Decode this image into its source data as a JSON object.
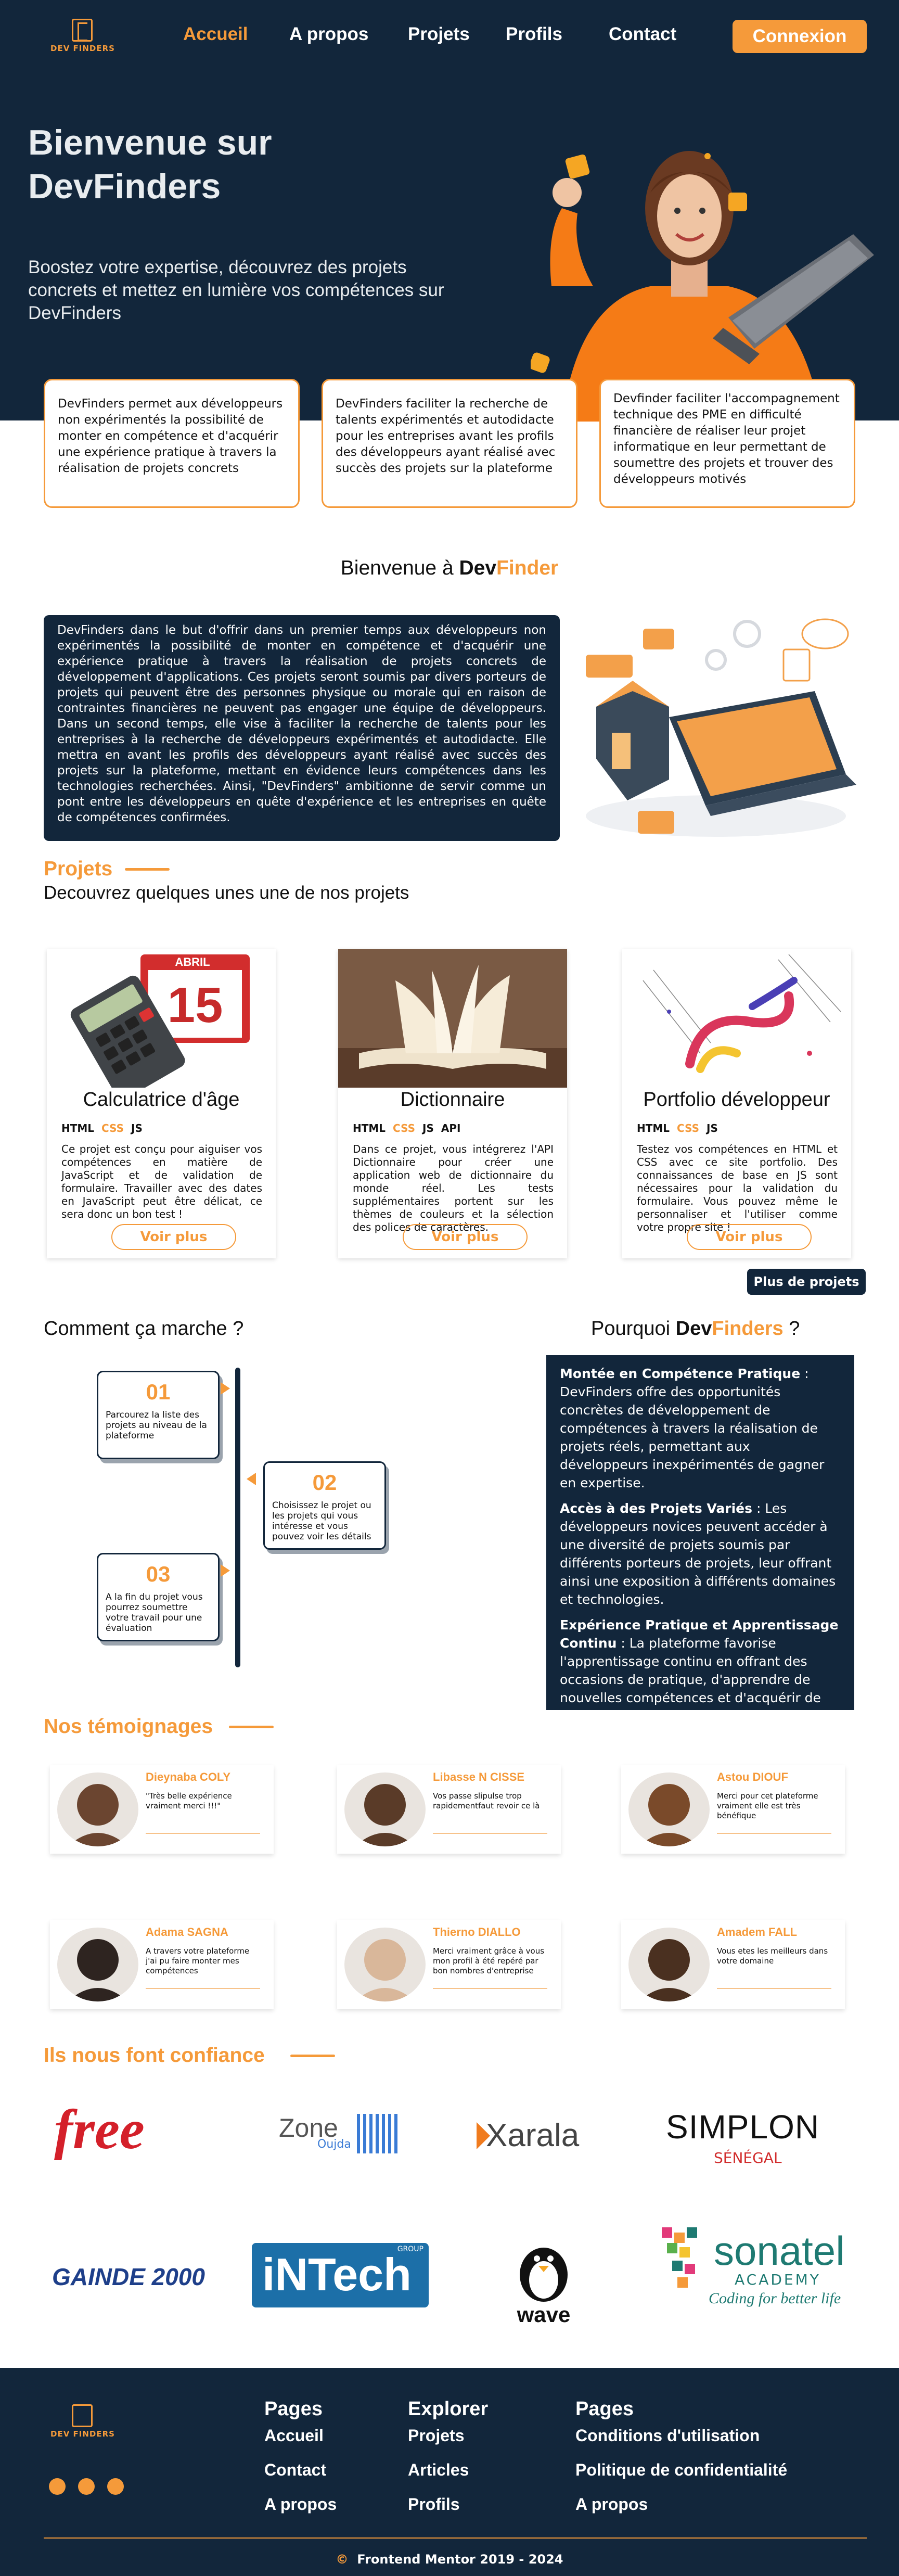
{
  "nav": {
    "logo_text": "DEV FINDERS",
    "items": [
      "Accueil",
      "A propos",
      "Projets",
      "Profils",
      "Contact"
    ],
    "login": "Connexion"
  },
  "hero": {
    "title": "Bienvenue sur DevFinders",
    "subtitle": "Boostez votre expertise, découvrez des projets concrets et mettez en lumière vos compétences sur DevFinders"
  },
  "features": [
    "DevFinders permet aux développeurs non expérimentés la possibilité de monter en compétence et d'acquérir une expérience pratique à travers la réalisation de projets concrets",
    "DevFinders faciliter la recherche de talents expérimentés et autodidacte pour les entreprises avant les profils des développeurs ayant réalisé avec succès des projets sur la plateforme",
    "Devfinder faciliter l'accompagnement technique des PME en difficulté financière de réaliser leur projet informatique en leur permettant de soumettre des projets et trouver des développeurs motivés"
  ],
  "welcome": {
    "prefix": "Bienvenue à ",
    "dev": "Dev",
    "finder": "Finder"
  },
  "about": "DevFinders dans le but d'offrir dans un premier temps aux développeurs non expérimentés la possibilité de monter en compétence et d'acquérir une expérience pratique à travers la réalisation de projets concrets de développement d'applications. Ces projets seront soumis par divers porteurs de projets qui peuvent être des personnes physique ou morale qui en raison de contraintes financières ne peuvent pas engager une équipe de développeurs. Dans un second temps, elle vise à faciliter la recherche de talents pour les entreprises à la recherche de développeurs expérimentés et autodidacte. Elle mettra en avant les profils des développeurs ayant réalisé avec succès des projets sur la plateforme, mettant en évidence leurs compétences dans les technologies recherchées. Ainsi, \"DevFinders\" ambitionne de servir comme un pont entre les développeurs en quête d'expérience et les entreprises en quête de compétences confirmées.",
  "projects": {
    "title": "Projets",
    "subtitle": "Decouvrez quelques unes une de nos projets",
    "items": [
      {
        "title": "Calculatrice d'âge",
        "tags": [
          "HTML",
          "CSS",
          "JS"
        ],
        "desc": "Ce projet est conçu pour aiguiser vos compétences en matière de JavaScript et de validation de formulaire. Travailler avec des dates en JavaScript peut être délicat, ce sera donc un bon test !",
        "btn": "Voir plus"
      },
      {
        "title": "Dictionnaire",
        "tags": [
          "HTML",
          "CSS",
          "JS",
          "API"
        ],
        "desc": "Dans ce projet, vous intégrerez l'API Dictionnaire pour créer une application web de dictionnaire du monde réel. Les tests supplémentaires portent sur les thèmes de couleurs et la sélection des polices de caractères.",
        "btn": "Voir plus"
      },
      {
        "title": "Portfolio développeur",
        "tags": [
          "HTML",
          "CSS",
          "JS"
        ],
        "desc": "Testez vos compétences en HTML et CSS avec ce site portfolio. Des connaissances de base en JS sont nécessaires pour la validation du formulaire. Vous pouvez même le personnaliser et l'utiliser comme votre propre site !",
        "btn": "Voir plus"
      }
    ],
    "more": "Plus de projets"
  },
  "how": {
    "title": "Comment ça marche ?",
    "steps": [
      {
        "num": "01",
        "text": "Parcourez la liste des projets au niveau de la plateforme"
      },
      {
        "num": "02",
        "text": "Choisissez le projet ou les projets qui vous intéresse et vous pouvez voir les détails"
      },
      {
        "num": "03",
        "text": "A la fin du projet vous pourrez soumettre votre travail pour une évaluation"
      }
    ]
  },
  "why": {
    "prefix": "Pourquoi ",
    "dev": "Dev",
    "finders": "Finders",
    " suffix": " ?",
    "items": [
      {
        "h": "Montée en Compétence Pratique",
        "t": " : DevFinders offre des opportunités concrètes de développement de compétences à travers la réalisation de projets réels, permettant aux développeurs inexpérimentés de gagner en expertise."
      },
      {
        "h": "Accès à des Projets Variés",
        "t": " : Les développeurs novices peuvent accéder à une diversité de projets soumis par différents porteurs de projets, leur offrant ainsi une exposition à différents domaines et technologies."
      },
      {
        "h": "Expérience Pratique et Apprentissage Continu",
        "t": " : La plateforme favorise l'apprentissage continu en offrant des occasions de pratique, d'apprendre de nouvelles compétences et d'acquérir de l'expérience pratique."
      }
    ]
  },
  "testimonials": {
    "title": "Nos témoignages",
    "items": [
      {
        "name": "Dieynaba COLY",
        "quote": "\"Très belle expérience vraiment merci !!!\"",
        "skin": "#6b4530"
      },
      {
        "name": "Libasse N CISSE",
        "quote": "Vos passe slipulse trop rapidementfaut revoir ce là",
        "skin": "#5a3b28"
      },
      {
        "name": "Astou DIOUF",
        "quote": "Merci pour cet plateforme vraiment elle est très bénéfique",
        "skin": "#7a4a2a"
      },
      {
        "name": "Adama SAGNA",
        "quote": "A travers votre plateforme j'ai pu faire monter mes compétences",
        "skin": "#2e2420"
      },
      {
        "name": "Thierno DIALLO",
        "quote": "Merci vraiment grâce à vous mon profil à été repéré par bon nombres d'entreprise",
        "skin": "#d9b79a"
      },
      {
        "name": "Amadem FALL",
        "quote": "Vous etes les meilleurs dans votre domaine",
        "skin": "#4a3020"
      }
    ]
  },
  "partners": {
    "title": "Ils nous font confiance",
    "logos": [
      {
        "name": "free",
        "text": "free",
        "color": "#d4202a"
      },
      {
        "name": "zone01",
        "text": "Zone",
        "sub": "Oujda",
        "color": "#555555"
      },
      {
        "name": "xarala",
        "text": "Xarala",
        "color": "#444444"
      },
      {
        "name": "simplon",
        "text": "SIMPLON",
        "sub": "SÉNÉGAL",
        "color": "#111111"
      },
      {
        "name": "gainde",
        "text": "GAINDE 2000",
        "color": "#1e3f8a"
      },
      {
        "name": "intech",
        "text": "iNTech",
        "sub": "GROUP",
        "color": "#1c6fa8"
      },
      {
        "name": "wave",
        "text": "wave",
        "color": "#111111"
      },
      {
        "name": "sonatel",
        "text": "sonatel",
        "sub": "ACADEMY",
        "tag": "Coding for better life",
        "color": "#1e7a72"
      }
    ]
  },
  "footer": {
    "cols": [
      {
        "h": "Pages",
        "links": [
          "Accueil",
          "Contact",
          "A propos"
        ]
      },
      {
        "h": "Explorer",
        "links": [
          "Projets",
          "Articles",
          "Profils"
        ]
      },
      {
        "h": "Pages",
        "links": [
          "Conditions d'utilisation",
          "Politique de confidentialité",
          "A propos"
        ]
      }
    ],
    "social": [
      "instagram-icon",
      "twitter-icon",
      "facebook-icon"
    ],
    "copy": "Frontend Mentor 2019 - 2024",
    "copy_symbol": "©"
  },
  "colors": {
    "navy": "#12263b",
    "orange": "#f59a3a"
  }
}
